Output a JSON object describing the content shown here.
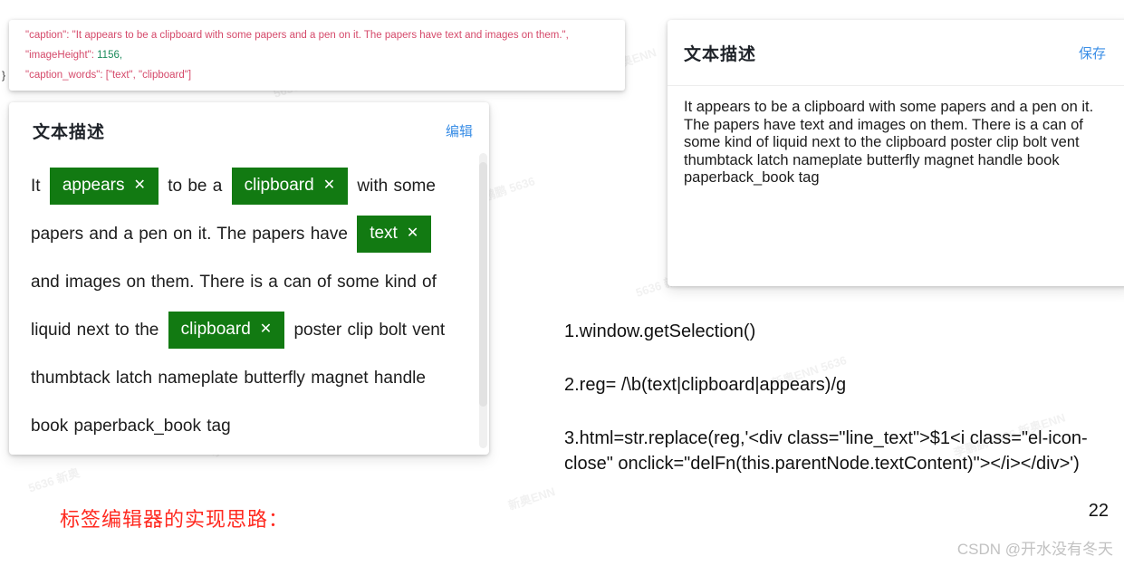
{
  "json_panel": {
    "lines": [
      {
        "key": "\"caption\":",
        "value": " \"It appears to be a clipboard with some papers and a pen on it. The papers have text and images on them.\",",
        "type": "string"
      },
      {
        "key": "\"imageHeight\":",
        "value": " 1156,",
        "type": "number"
      },
      {
        "key": "\"caption_words\":",
        "value": " [\"text\", \"clipboard\"]",
        "type": "string"
      }
    ],
    "closing_brace": "}"
  },
  "left_card": {
    "title": "文本描述",
    "action_label": "编辑",
    "segments": [
      {
        "type": "text",
        "value": "It "
      },
      {
        "type": "tag",
        "value": "appears",
        "close": "✕"
      },
      {
        "type": "text",
        "value": " to be a "
      },
      {
        "type": "tag",
        "value": "clipboard",
        "close": "✕"
      },
      {
        "type": "text",
        "value": " with some papers and a pen on it. The papers have "
      },
      {
        "type": "tag",
        "value": "text",
        "close": "✕"
      },
      {
        "type": "text",
        "value": " and images on them. There is a can of some kind of liquid next to the "
      },
      {
        "type": "tag",
        "value": "clipboard",
        "close": "✕"
      },
      {
        "type": "text",
        "value": " poster clip bolt vent thumbtack latch nameplate butterfly magnet handle book paperback_book tag"
      }
    ]
  },
  "right_card": {
    "title": "文本描述",
    "action_label": "保存",
    "textarea_value": "It appears to be a clipboard with some papers and a pen on it. The papers have text and images on them. There is a can of some kind of liquid next to the clipboard poster clip bolt vent thumbtack latch nameplate butterfly magnet handle book paperback_book tag"
  },
  "code_list": [
    "1.window.getSelection()",
    "2.reg= /\\b(text|clipboard|appears)/g",
    "3.html=str.replace(reg,'<div class=\"line_text\">$1<i class=\"el-icon-close\" onclick=\"delFn(this.parentNode.textContent)\"></i></div>')"
  ],
  "red_caption": "标签编辑器的实现思路：",
  "page_number": "22",
  "watermark": "CSDN @开水没有冬天",
  "colors": {
    "tag_green": "#127a12",
    "link_blue": "#3a8ee6",
    "json_string": "#d5496a",
    "json_number": "#1a8a5a",
    "red_caption": "#ff2a20"
  },
  "watermarks_faint": [
    "李鹏鹏 5636 新奥ENN",
    "5636 新奥ENN",
    "李鹏鹏 5636",
    "新奥ENN 5636",
    "5636 新奥ENN",
    "李鹏鹏 5636 新奥ENN",
    "5636 新奥ENN",
    "新奥ENN",
    "李鹏鹏 5636",
    "5636 新奥ENN",
    "新奥ENN 5636",
    "李鹏鹏 5636 新奥ENN",
    "5636 新奥",
    "新奥ENN",
    "5636 新奥ENN"
  ]
}
